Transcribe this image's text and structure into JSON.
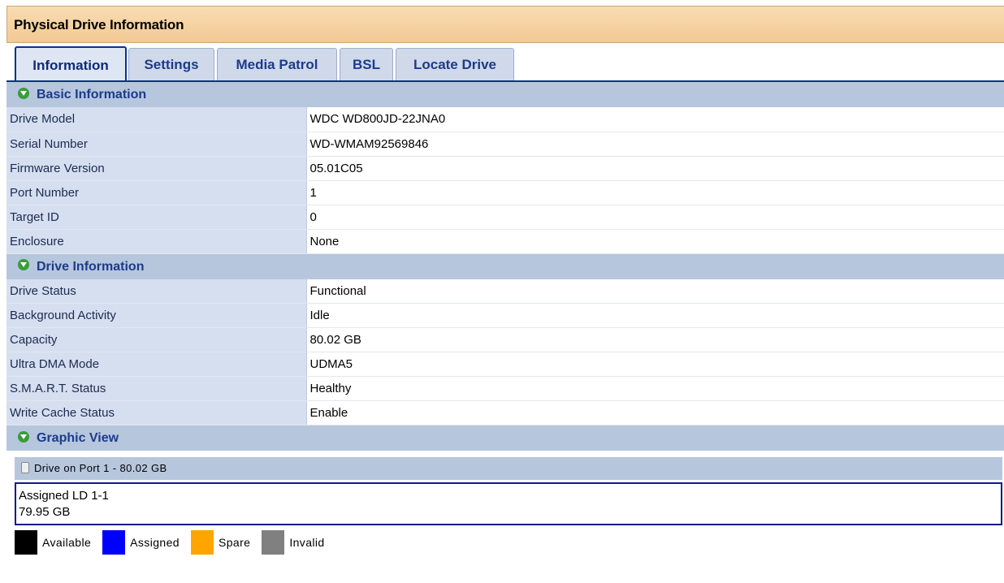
{
  "title": "Physical Drive Information",
  "tabs": [
    {
      "label": "Information",
      "active": true
    },
    {
      "label": "Settings"
    },
    {
      "label": "Media Patrol"
    },
    {
      "label": "BSL"
    },
    {
      "label": "Locate Drive"
    }
  ],
  "basic": {
    "header": "Basic Information",
    "rows": [
      {
        "label": "Drive Model",
        "value": "WDC WD800JD-22JNA0"
      },
      {
        "label": "Serial Number",
        "value": "WD-WMAM92569846"
      },
      {
        "label": "Firmware Version",
        "value": "05.01C05"
      },
      {
        "label": "Port Number",
        "value": "1"
      },
      {
        "label": "Target ID",
        "value": "0"
      },
      {
        "label": "Enclosure",
        "value": "None"
      }
    ]
  },
  "drive": {
    "header": "Drive Information",
    "rows": [
      {
        "label": "Drive Status",
        "value": "Functional"
      },
      {
        "label": "Background Activity",
        "value": "Idle"
      },
      {
        "label": "Capacity",
        "value": "80.02 GB"
      },
      {
        "label": "Ultra DMA Mode",
        "value": "UDMA5"
      },
      {
        "label": "S.M.A.R.T. Status",
        "value": "Healthy"
      },
      {
        "label": "Write Cache Status",
        "value": "Enable"
      }
    ]
  },
  "graphic": {
    "header": "Graphic View",
    "drive_label": "Drive on Port 1 - 80.02 GB",
    "ld_name": "Assigned LD 1-1",
    "ld_size": "79.95 GB",
    "legend": [
      {
        "label": "Available",
        "color": "#000000"
      },
      {
        "label": "Assigned",
        "color": "#0000ff"
      },
      {
        "label": "Spare",
        "color": "#ffa500"
      },
      {
        "label": "Invalid",
        "color": "#808080"
      }
    ]
  },
  "icons": {
    "section_toggle": "chevron-down-icon",
    "drive": "disk-icon"
  }
}
